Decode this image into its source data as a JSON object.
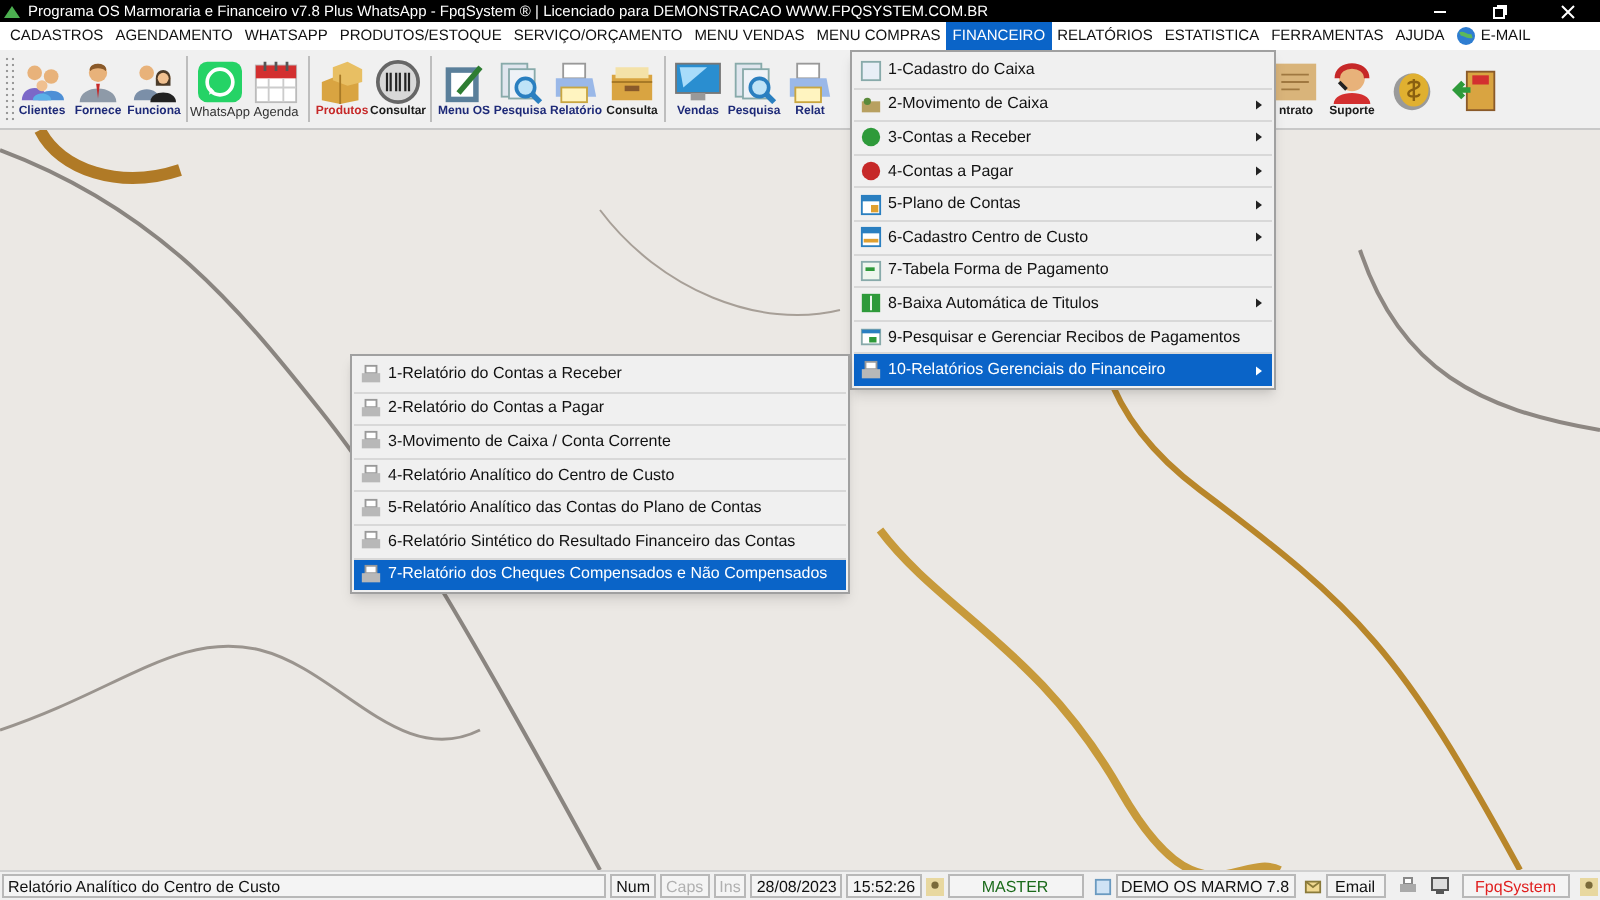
{
  "window": {
    "title": "Programa OS Marmoraria e Financeiro v7.8 Plus WhatsApp - FpqSystem ® | Licenciado para  DEMONSTRACAO WWW.FPQSYSTEM.COM.BR"
  },
  "menu_bar": [
    {
      "label": "CADASTROS",
      "selected": false,
      "kind": "text"
    },
    {
      "label": "AGENDAMENTO",
      "selected": false,
      "kind": "text"
    },
    {
      "label": "WHATSAPP",
      "selected": false,
      "kind": "text"
    },
    {
      "label": "PRODUTOS/ESTOQUE",
      "selected": false,
      "kind": "text"
    },
    {
      "label": "SERVIÇO/ORÇAMENTO",
      "selected": false,
      "kind": "text"
    },
    {
      "label": "MENU VENDAS",
      "selected": false,
      "kind": "text"
    },
    {
      "label": "MENU COMPRAS",
      "selected": false,
      "kind": "text"
    },
    {
      "label": "FINANCEIRO",
      "selected": true,
      "kind": "text"
    },
    {
      "label": "RELATÓRIOS",
      "selected": false,
      "kind": "text"
    },
    {
      "label": "ESTATISTICA",
      "selected": false,
      "kind": "text"
    },
    {
      "label": "FERRAMENTAS",
      "selected": false,
      "kind": "text"
    },
    {
      "label": "AJUDA",
      "selected": false,
      "kind": "text"
    },
    {
      "label": "E-MAIL",
      "selected": false,
      "kind": "globe"
    }
  ],
  "toolbar": {
    "groups": [
      [
        {
          "label": "Clientes",
          "kind": "people",
          "color": "#1e2a78"
        },
        {
          "label": "Fornece",
          "kind": "man",
          "color": "#1e2a78"
        },
        {
          "label": "Funciona",
          "kind": "woman",
          "color": "#1e2a78"
        }
      ],
      [
        {
          "label": "WhatsApp",
          "kind": "whatsapp",
          "color": "#333333"
        },
        {
          "label": "Agenda",
          "kind": "calendar",
          "color": "#333333"
        }
      ],
      [
        {
          "label": "Produtos",
          "kind": "boxes",
          "color": "#c62828"
        },
        {
          "label": "Consultar",
          "kind": "barcode",
          "color": "#1a1a1a"
        }
      ],
      [
        {
          "label": "Menu OS",
          "kind": "clipboard",
          "color": "#1e2a78"
        },
        {
          "label": "Pesquisa",
          "kind": "search",
          "color": "#1e2a78"
        },
        {
          "label": "Relatório",
          "kind": "printer",
          "color": "#1e2a78"
        },
        {
          "label": "Consulta",
          "kind": "folder",
          "color": "#1a1a1a"
        }
      ],
      [
        {
          "label": "Vendas",
          "kind": "monitor",
          "color": "#1e2a78"
        },
        {
          "label": "Pesquisa",
          "kind": "search",
          "color": "#1e2a78"
        },
        {
          "label": "Relat",
          "kind": "printer",
          "color": "#1e2a78"
        }
      ],
      [
        {
          "label": "ntrato",
          "kind": "scroll",
          "color": "#1a1a1a"
        },
        {
          "label": "Suporte",
          "kind": "support",
          "color": "#1a1a1a"
        },
        {
          "kind": "coin"
        },
        {
          "kind": "exit"
        }
      ]
    ]
  },
  "financeiro_menu": [
    {
      "label": "1-Cadastro do Caixa",
      "submenu": false,
      "selected": false
    },
    {
      "label": "2-Movimento de Caixa",
      "submenu": true,
      "selected": false
    },
    {
      "label": "3-Contas a Receber",
      "submenu": true,
      "selected": false
    },
    {
      "label": "4-Contas a Pagar",
      "submenu": true,
      "selected": false
    },
    {
      "label": "5-Plano de Contas",
      "submenu": true,
      "selected": false
    },
    {
      "label": "6-Cadastro Centro de Custo",
      "submenu": true,
      "selected": false
    },
    {
      "label": "7-Tabela Forma de Pagamento",
      "submenu": false,
      "selected": false
    },
    {
      "label": "8-Baixa Automática de Titulos",
      "submenu": true,
      "selected": false
    },
    {
      "label": "9-Pesquisar e Gerenciar Recibos de Pagamentos",
      "submenu": false,
      "selected": false
    },
    {
      "label": "10-Relatórios Gerenciais do Financeiro",
      "submenu": true,
      "selected": true
    }
  ],
  "reports_submenu": [
    {
      "label": "1-Relatório do Contas a Receber",
      "selected": false
    },
    {
      "label": "2-Relatório do Contas a Pagar",
      "selected": false
    },
    {
      "label": "3-Movimento de Caixa / Conta Corrente",
      "selected": false
    },
    {
      "label": "4-Relatório Analítico do Centro de Custo",
      "selected": false
    },
    {
      "label": "5-Relatório Analítico das Contas do Plano de Contas",
      "selected": false
    },
    {
      "label": "6-Relatório Sintético do Resultado Financeiro das Contas",
      "selected": false
    },
    {
      "label": "7-Relatório dos Cheques Compensados e Não Compensados",
      "selected": true
    }
  ],
  "status_bar": {
    "message": "Relatório Analítico do Centro de Custo",
    "indicators": [
      {
        "label": "Num",
        "disabled": false
      },
      {
        "label": "Caps",
        "disabled": true
      },
      {
        "label": "Ins",
        "disabled": true
      }
    ],
    "date": "28/08/2023",
    "time": "15:52:26",
    "user": "MASTER",
    "company": "DEMO OS MARMO 7.8",
    "email": "Email",
    "brand": "FpqSystem"
  }
}
